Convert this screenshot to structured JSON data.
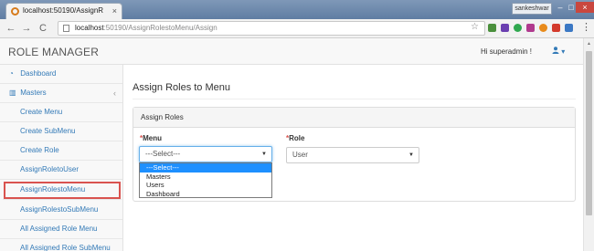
{
  "browser": {
    "tab_title": "localhost:50190/AssignR",
    "tab_close": "×",
    "window_user": "sankeshwar",
    "url_host": "localhost",
    "url_path": ":50190/AssignRolestoMenu/Assign",
    "back": "←",
    "forward": "→",
    "reload": "C",
    "star": "☆",
    "menu": "⋮",
    "win_min": "–",
    "win_max": "□",
    "win_close": "×"
  },
  "header": {
    "brand": "ROLE MANAGER",
    "greeting": "Hi superadmin !",
    "user_caret": "▾"
  },
  "sidebar": {
    "items": [
      {
        "label": "Dashboard",
        "icon": "dashboard-icon"
      },
      {
        "label": "Masters",
        "icon": "bar-chart-icon"
      },
      {
        "label": "Create Menu"
      },
      {
        "label": "Create SubMenu"
      },
      {
        "label": "Create Role"
      },
      {
        "label": "AssignRoletoUser"
      },
      {
        "label": "AssignRolestoMenu"
      },
      {
        "label": "AssignRolestoSubMenu"
      },
      {
        "label": "All Assigned Role Menu"
      },
      {
        "label": "All Assigned Role SubMenu"
      }
    ],
    "masters_chevron": "‹"
  },
  "main": {
    "page_title": "Assign Roles to Menu",
    "panel_title": "Assign Roles",
    "menu_label": "Menu",
    "role_label": "Role",
    "required_mark": "*",
    "menu_value": "---Select---",
    "role_value": "User",
    "menu_options": [
      "---Select---",
      "Masters",
      "Users",
      "Dashboard"
    ]
  },
  "colors": {
    "link": "#337ab7",
    "required": "#d9534f",
    "highlight_box": "#d9534f",
    "selected_option": "#1e90ff"
  }
}
